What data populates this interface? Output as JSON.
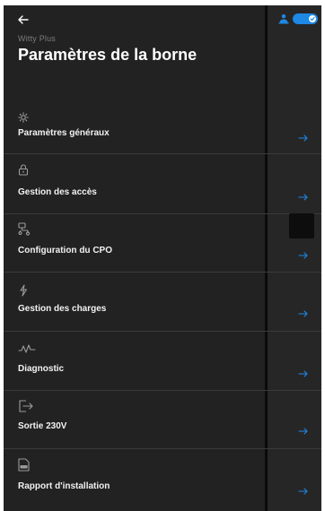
{
  "header": {
    "back_icon": "arrow-left-icon",
    "subtitle": "Witty Plus",
    "title": "Paramètres de la borne"
  },
  "status": {
    "person_icon": "person-icon",
    "toggle_on": true,
    "accent_color": "#1e88e5"
  },
  "menu": {
    "items": [
      {
        "label": "Paramètres généraux",
        "icon": "gear-icon"
      },
      {
        "label": "Gestion des accès",
        "icon": "lock-icon"
      },
      {
        "label": "Configuration du CPO",
        "icon": "network-icon"
      },
      {
        "label": "Gestion des charges",
        "icon": "lightning-icon"
      },
      {
        "label": "Diagnostic",
        "icon": "pulse-icon"
      },
      {
        "label": "Sortie 230V",
        "icon": "plug-out-icon"
      },
      {
        "label": "Rapport d'installation",
        "icon": "pdf-document-icon"
      }
    ]
  }
}
